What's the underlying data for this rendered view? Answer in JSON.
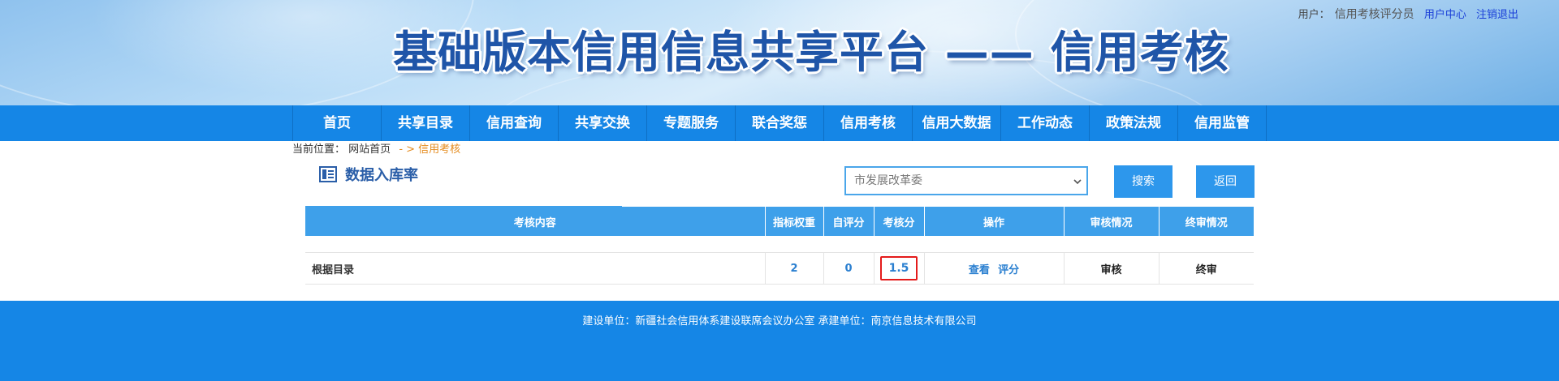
{
  "header": {
    "site_title": "基础版本信用信息共享平台 —— 信用考核",
    "user_label": "用户：",
    "user_name": "信用考核评分员",
    "user_center": "用户中心",
    "logout": "注销退出"
  },
  "nav": {
    "items": [
      {
        "label": "首页"
      },
      {
        "label": "共享目录"
      },
      {
        "label": "信用查询"
      },
      {
        "label": "共享交换"
      },
      {
        "label": "专题服务"
      },
      {
        "label": "联合奖惩"
      },
      {
        "label": "信用考核"
      },
      {
        "label": "信用大数据"
      },
      {
        "label": "工作动态"
      },
      {
        "label": "政策法规"
      },
      {
        "label": "信用监管"
      }
    ]
  },
  "breadcrumb": {
    "label": "当前位置：",
    "home": "网站首页",
    "separator": "- >",
    "current": "信用考核"
  },
  "section": {
    "title": "数据入库率",
    "icon": "document-list-icon"
  },
  "search": {
    "department_selected": "市发展改革委",
    "search_label": "搜索",
    "back_label": "返回"
  },
  "table": {
    "headers": [
      "考核内容",
      "指标权重",
      "自评分",
      "考核分",
      "操作",
      "审核情况",
      "终审情况"
    ],
    "rows": [
      {
        "content": "根据目录",
        "weight": "2",
        "self_score": "0",
        "assess_score": "1.5",
        "op_view": "查看",
        "op_score": "评分",
        "review": "审核",
        "final_review": "终审"
      }
    ]
  },
  "footer": {
    "text": "建设单位：新疆社会信用体系建设联席会议办公室 承建单位：南京信息技术有限公司"
  },
  "colors": {
    "primary": "#1586e6",
    "table_header": "#3ea0ea",
    "title_text": "#1f55a8",
    "breadcrumb_accent": "#e48a1c",
    "score_highlight": "#e41b1b"
  }
}
